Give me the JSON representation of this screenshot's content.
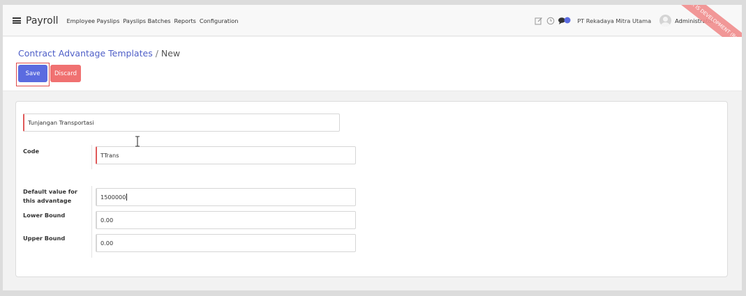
{
  "navbar": {
    "app_name": "Payroll",
    "menu_items": [
      "Employee Payslips",
      "Payslips Batches",
      "Reports",
      "Configuration"
    ],
    "company": "PT Rekadaya Mitra Utama",
    "user": "Administrator",
    "icons": [
      "menu-icon",
      "edit-note-icon",
      "clock-icon",
      "chat-icon"
    ],
    "ribbon": "SERVER IS DEVELOPMENT (Rekadaya)"
  },
  "breadcrumb": {
    "parent": "Contract Advantage Templates",
    "separator": "/",
    "current": "New"
  },
  "buttons": {
    "save": "Save",
    "discard": "Discard"
  },
  "form": {
    "name_value": "Tunjangan Transportasi",
    "code_label": "Code",
    "code_value": "TTrans",
    "default_value_label": "Default value for this advantage",
    "default_value": "1500000",
    "lower_bound_label": "Lower Bound",
    "lower_bound_value": "0.00",
    "upper_bound_label": "Upper Bound",
    "upper_bound_value": "0.00"
  },
  "colors": {
    "primary": "#5b6be0",
    "danger": "#f07171",
    "link": "#4e5ec7",
    "required": "#e05a5a"
  }
}
